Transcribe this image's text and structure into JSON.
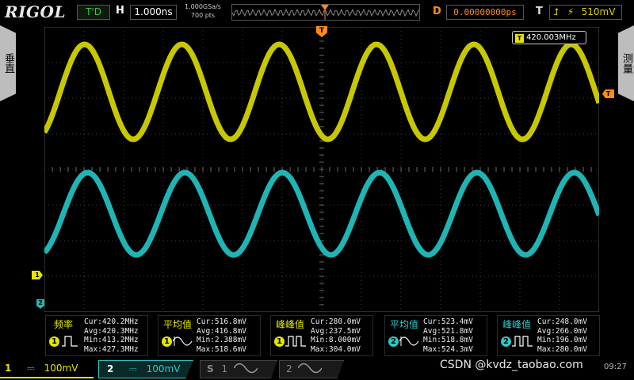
{
  "brand": "RIGOL",
  "top": {
    "run_status": "T'D",
    "h_label": "H",
    "time_scale": "1.000ns",
    "sample_rate": "1.000GSa/s",
    "mem_depth": "700 pts",
    "d_label": "D",
    "delay": "0.00000000ps",
    "t_label": "T",
    "trigger_level": "510mV"
  },
  "side": {
    "left_tab": "垂直",
    "right_tab": "测量"
  },
  "screen": {
    "trigger_marker": "T",
    "freq_readout": "420.003MHz",
    "ch1_marker": "1",
    "ch2_marker": "2",
    "trig_level_marker": "T"
  },
  "measurements": [
    {
      "name": "频率",
      "source": "1",
      "cur": "Cur:420.2MHz",
      "avg": "Avg:420.3MHz",
      "min": "Min:413.2MHz",
      "max": "Max:427.3MHz"
    },
    {
      "name": "平均值",
      "source": "1",
      "cur": "Cur:516.8mV",
      "avg": "Avg:416.8mV",
      "min": "Min:2.388mV",
      "max": "Max:518.6mV"
    },
    {
      "name": "峰峰值",
      "source": "1",
      "cur": "Cur:280.0mV",
      "avg": "Avg:237.5mV",
      "min": "Min:8.000mV",
      "max": "Max:304.0mV"
    },
    {
      "name": "平均值",
      "source": "2",
      "cur": "Cur:523.4mV",
      "avg": "Avg:521.8mV",
      "min": "Min:518.8mV",
      "max": "Max:524.3mV"
    },
    {
      "name": "峰峰值",
      "source": "2",
      "cur": "Cur:248.0mV",
      "avg": "Avg:266.0mV",
      "min": "Min:196.0mV",
      "max": "Max:280.0mV"
    }
  ],
  "bottom": {
    "ch1_num": "1",
    "ch1_scale": "100mV",
    "ch2_num": "2",
    "ch2_scale": "100mV",
    "s1_label": "S",
    "s1_num": "1",
    "s2_num": "2",
    "watermark": "CSDN @kvdz_taobao.com",
    "clock": "09:27"
  },
  "colors": {
    "ch1": "#c8c800",
    "ch2": "#1fb5b5",
    "trigger": "#ff8c1a"
  }
}
